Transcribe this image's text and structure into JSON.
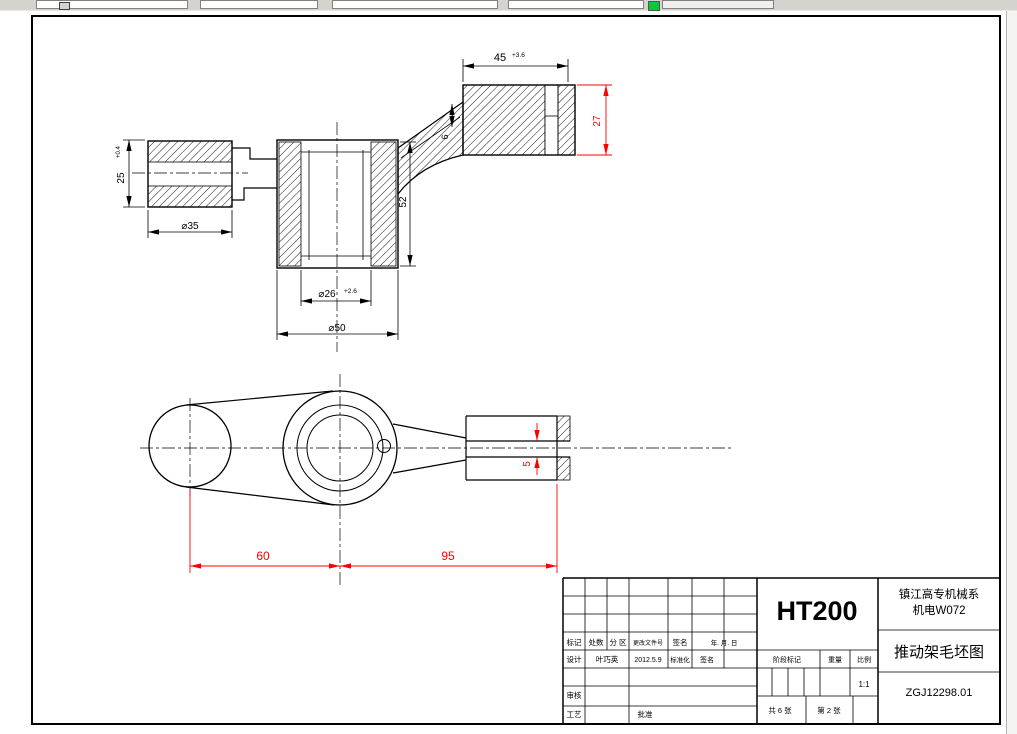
{
  "toolbar": {
    "swatch_color": "#00cc33"
  },
  "drawing": {
    "line_color": "#000000",
    "dim_color": "#ff0000",
    "hatch_color": "#000000",
    "dims": {
      "len45": "45",
      "len45_tol": "+3.6",
      "h25": "25",
      "h25_tol": "+0.4",
      "h27": "27",
      "dia35": "⌀35",
      "dia26": "⌀26",
      "dia26_tol": "+2.6",
      "dia50": "⌀50",
      "h52": "52",
      "web6": "6",
      "len60": "60",
      "len95": "95",
      "slot5": "5"
    }
  },
  "title_block": {
    "material": "HT200",
    "org_line1": "镇江高专机械系",
    "org_line2": "机电W072",
    "drawing_title": "推动架毛坯图",
    "drawing_no": "ZGJ12298.01",
    "header_row": [
      "标记",
      "处数",
      "分 区",
      "更改文件号",
      "签名",
      "年. 月. 日"
    ],
    "design_row": {
      "label": "设计",
      "name": "叶巧英",
      "date": "2012.5.9",
      "std": "标准化",
      "sign": "签名"
    },
    "stage_label": "阶段标记",
    "weight_label": "重量",
    "scale_label": "比例",
    "scale_value": "1:1",
    "review_label": "审核",
    "process_label": "工艺",
    "approve_label": "批准",
    "sheet_total": "共 6 张",
    "sheet_no": "第 2 张"
  }
}
